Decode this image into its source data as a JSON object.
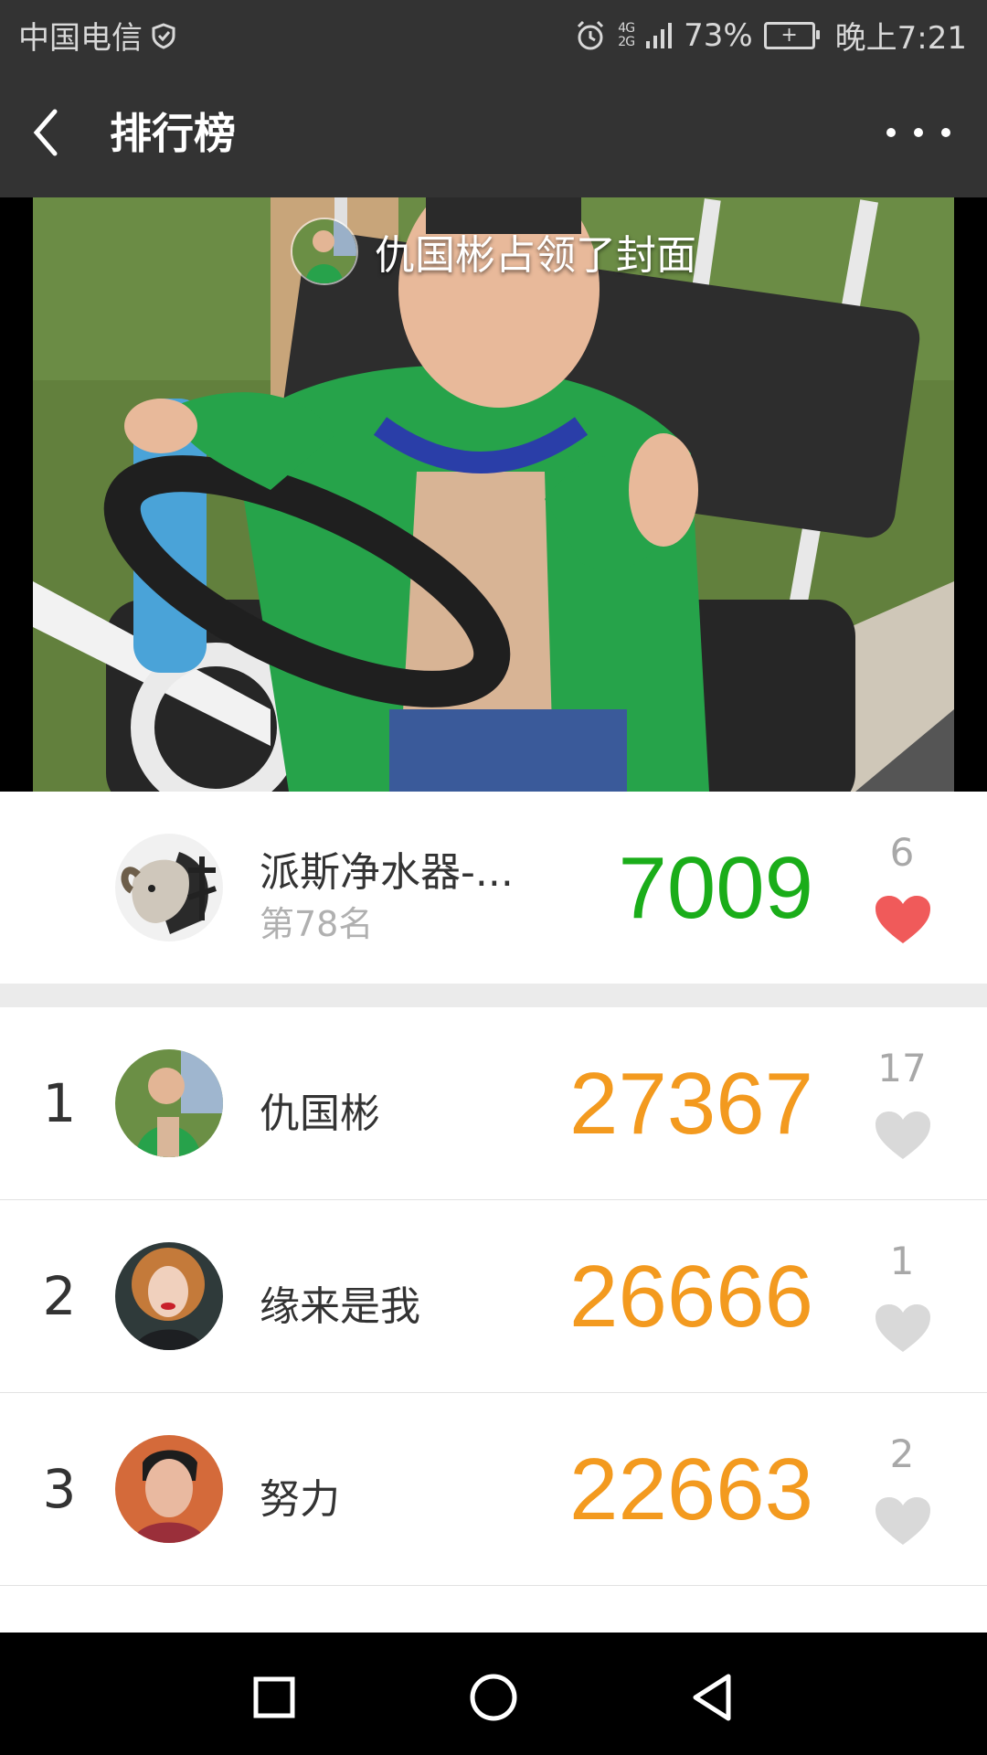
{
  "status_bar": {
    "carrier": "中国电信",
    "network_top": "4G",
    "network_bottom": "2G",
    "battery_percent": "73%",
    "time": "晚上7:21"
  },
  "header": {
    "title": "排行榜"
  },
  "cover": {
    "caption": "仇国彬占领了封面"
  },
  "my_rank": {
    "name": "派斯净水器-...",
    "rank_text": "第78名",
    "steps": "7009",
    "likes": "6",
    "liked": true
  },
  "ranking": [
    {
      "rank": "1",
      "name": "仇国彬",
      "steps": "27367",
      "likes": "17"
    },
    {
      "rank": "2",
      "name": "缘来是我",
      "steps": "26666",
      "likes": "1"
    },
    {
      "rank": "3",
      "name": "努力",
      "steps": "22663",
      "likes": "2"
    }
  ],
  "colors": {
    "my_steps": "#1aad19",
    "steps": "#f39a1f",
    "heart_active": "#f05a5a",
    "heart_inactive": "#d9d9d9"
  },
  "icons": [
    "back-icon",
    "more-icon",
    "heart-icon",
    "alarm-icon",
    "signal-icon",
    "battery-icon",
    "home-icon",
    "recents-icon",
    "nav-back-icon"
  ]
}
